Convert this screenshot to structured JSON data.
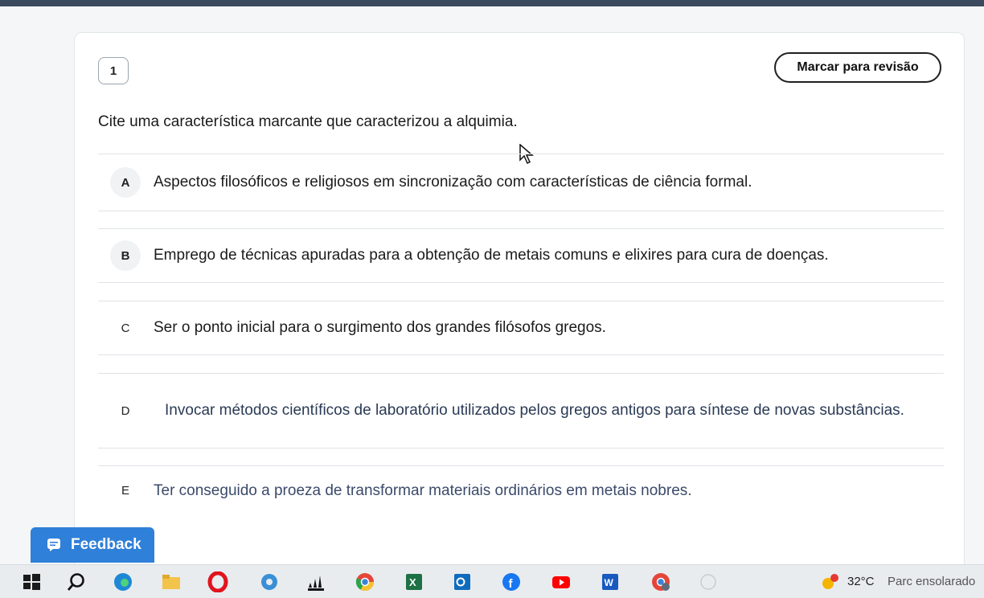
{
  "question": {
    "number": "1",
    "review_button": "Marcar para revisão",
    "text": "Cite uma característica marcante que caracterizou a alquimia."
  },
  "options": [
    {
      "letter": "A",
      "text": "Aspectos filosóficos e religiosos em sincronização com características de ciência formal."
    },
    {
      "letter": "B",
      "text": "Emprego de técnicas apuradas para a obtenção de metais comuns e elixires para cura de doenças."
    },
    {
      "letter": "C",
      "text": "Ser o ponto inicial para o surgimento dos grandes filósofos gregos."
    },
    {
      "letter": "D",
      "text": "Invocar métodos científicos de laboratório utilizados pelos gregos antigos para síntese de novas substâncias."
    },
    {
      "letter": "E",
      "text": "Ter conseguido a proeza de transformar materiais ordinários em metais nobres."
    }
  ],
  "feedback": {
    "label": "Feedback",
    "icon": "chat-icon"
  },
  "taskbar": {
    "icons": [
      "windows-start-icon",
      "search-icon",
      "edge-icon",
      "file-explorer-icon",
      "opera-icon",
      "app-icon",
      "adidas-icon",
      "chrome-icon",
      "excel-icon",
      "outlook-icon",
      "facebook-icon",
      "youtube-icon",
      "word-icon",
      "chrome-profile-icon",
      "circle-icon"
    ],
    "temperature": "32°C",
    "weather": "Parc ensolarado"
  },
  "colors": {
    "accent": "#2f80d9",
    "taskbar": "#e9ecef",
    "border": "#dfe3e7"
  }
}
